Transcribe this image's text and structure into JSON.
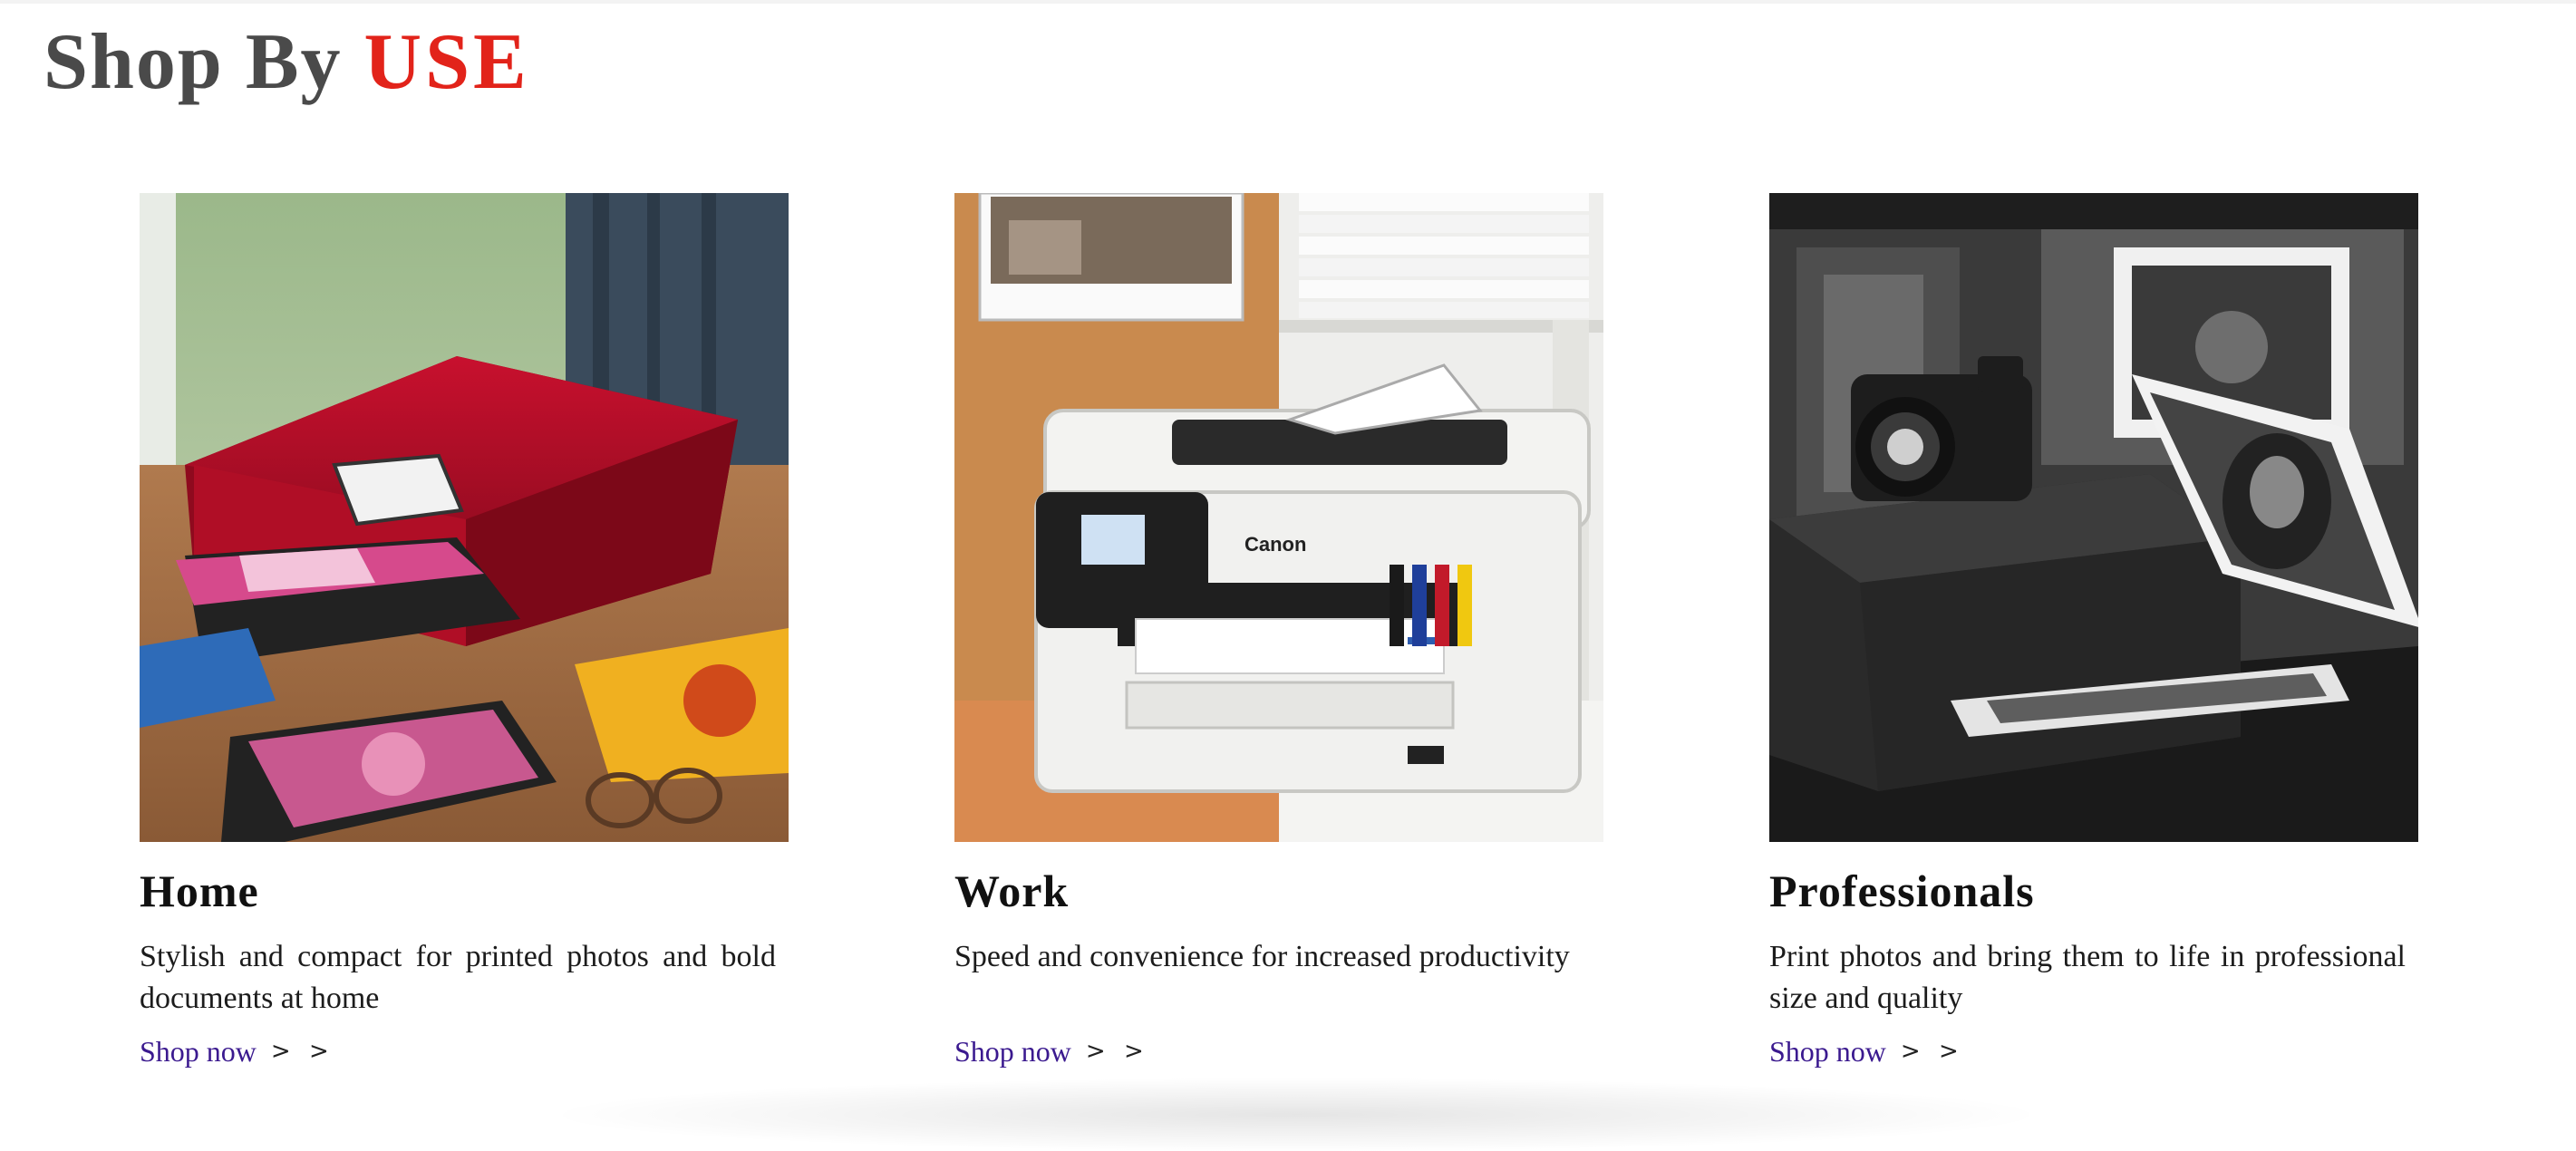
{
  "section": {
    "heading_prefix": "Shop By",
    "heading_accent": "USE",
    "accent_color": "#e2231a"
  },
  "cards": [
    {
      "title": "Home",
      "description": "Stylish and compact for printed photos and bold documents at home",
      "link_label": "Shop now",
      "chevrons": "> >",
      "image": "red-canon-photo-printer-on-wooden-table"
    },
    {
      "title": "Work",
      "description": "Speed and convenience for increased productivity",
      "link_label": "Shop now",
      "chevrons": "> >",
      "image": "white-canon-office-printer-with-ink-tanks",
      "image_brand": "Canon"
    },
    {
      "title": "Professionals",
      "description": "Print photos and bring them to life in professional size and quality",
      "link_label": "Shop now",
      "chevrons": "> >",
      "image": "black-and-white-professional-printer-with-camera"
    }
  ]
}
